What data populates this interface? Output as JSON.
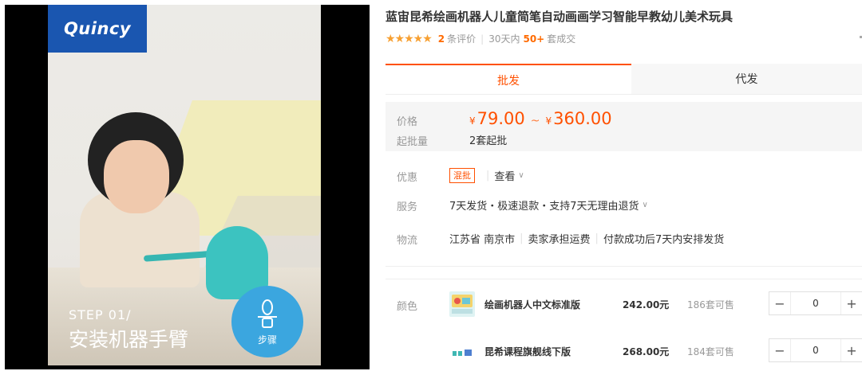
{
  "media": {
    "brand": "Quincy",
    "step_small": "STEP 01/",
    "step_big": "安装机器手臂",
    "badge_label": "步骤"
  },
  "product": {
    "title": "蓝宙昆希绘画机器人儿童简笔自动画画学习智能早教幼儿美术玩具",
    "review_count": "2",
    "review_label": "条评价",
    "sales_period": "30天内",
    "sales_count": "50+",
    "sales_label": "套成交"
  },
  "tabs": [
    {
      "label": "批发",
      "active": true
    },
    {
      "label": "代发",
      "active": false
    }
  ],
  "pricing": {
    "price_label": "价格",
    "currency": "¥",
    "price_min": "79.00",
    "price_max": "360.00",
    "moq_label": "起批量",
    "moq_value": "2套起批",
    "accent_color": "#ff5000"
  },
  "discount": {
    "label": "优惠",
    "tag": "混批",
    "link": "查看"
  },
  "service": {
    "label": "服务",
    "value": "7天发货・极速退款・支持7天无理由退货"
  },
  "logistics": {
    "label": "物流",
    "origin": "江苏省 南京市",
    "freight": "卖家承担运费",
    "ship_time": "付款成功后7天内安排发货"
  },
  "sku": {
    "label": "颜色",
    "items": [
      {
        "name": "绘画机器人中文标准版",
        "price": "242.00元",
        "stock": "186套可售",
        "qty": "0"
      },
      {
        "name": "昆希课程旗舰线下版",
        "price": "268.00元",
        "stock": "184套可售",
        "qty": "0"
      }
    ],
    "minus": "−",
    "plus": "+"
  },
  "icons": {
    "stars": "star-icon",
    "badge": "robot-step-icon",
    "chevron": "chevron-down-icon"
  }
}
